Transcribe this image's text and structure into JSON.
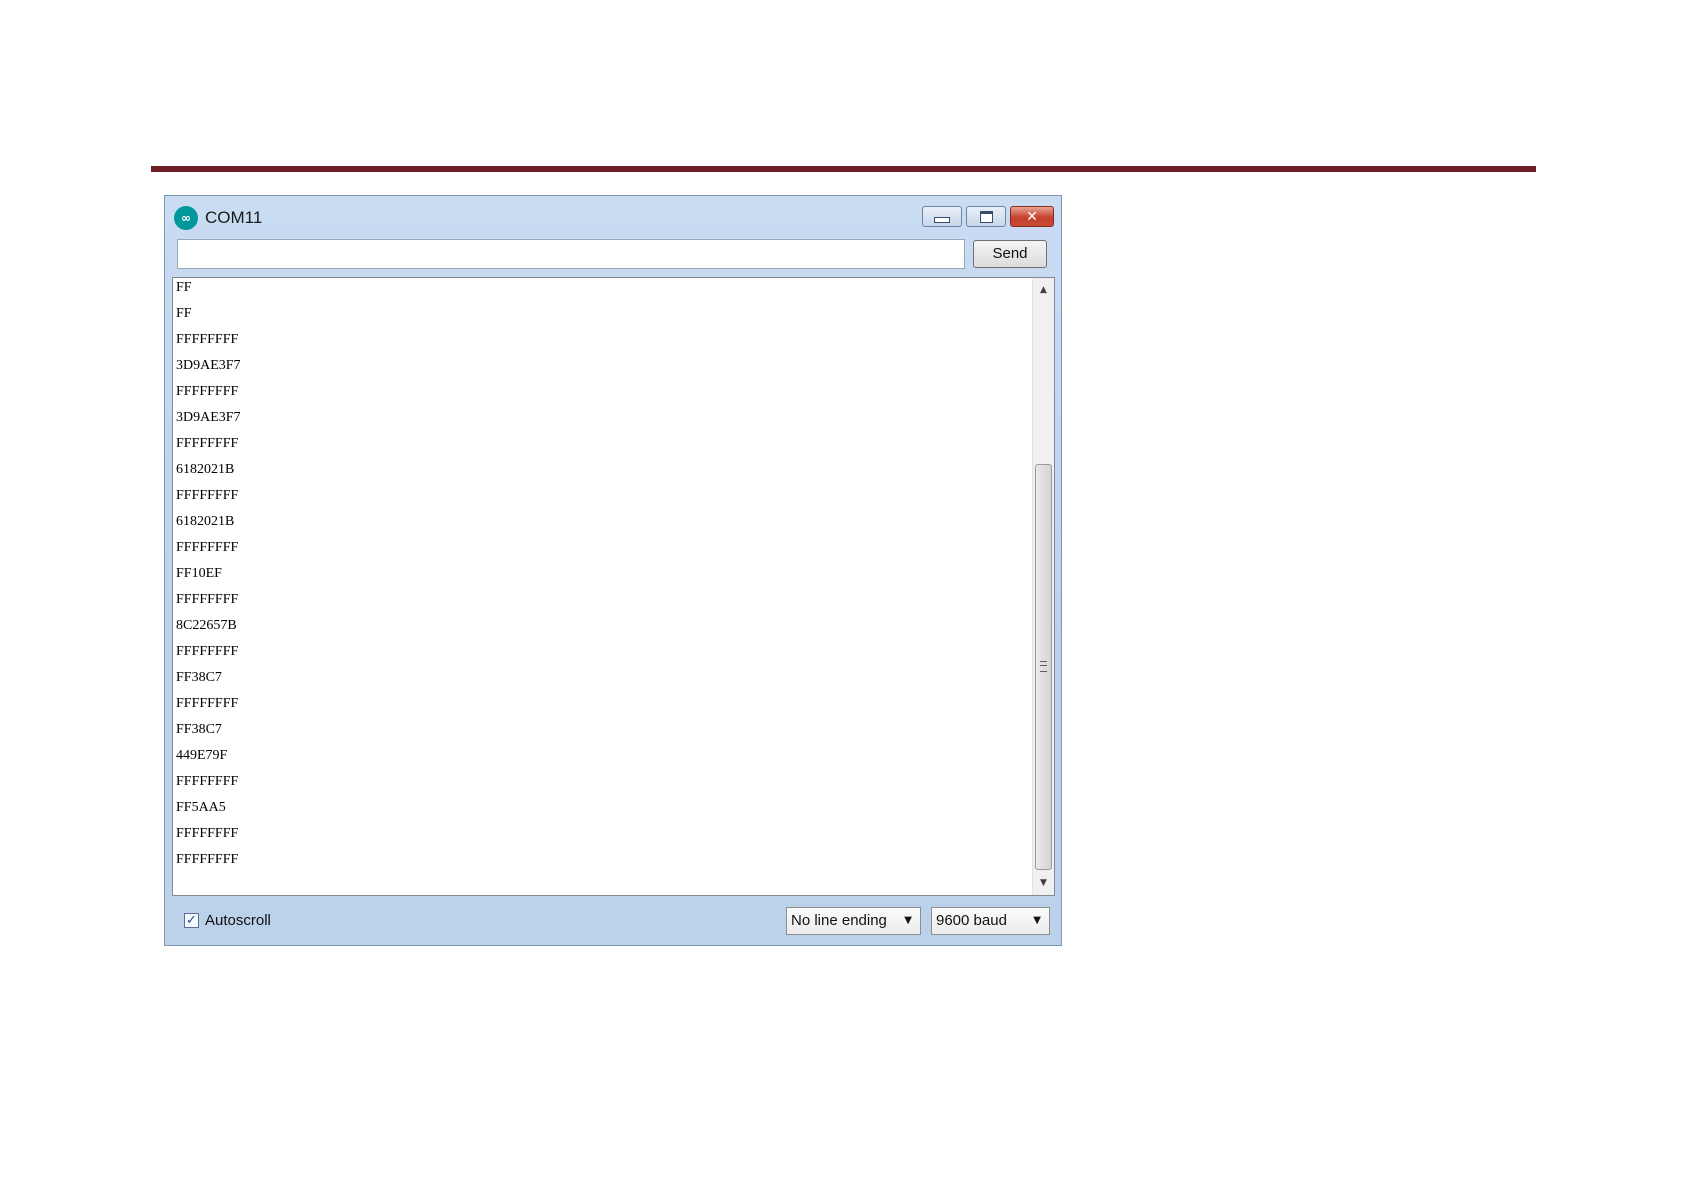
{
  "window": {
    "title": "COM11",
    "app_icon": "arduino-logo-icon",
    "app_icon_glyph": "∞",
    "controls": {
      "minimize": "minimize-icon",
      "maximize": "maximize-icon",
      "close": "close-icon",
      "close_glyph": "✕"
    }
  },
  "input": {
    "value": "",
    "placeholder": "",
    "send_label": "Send"
  },
  "output": {
    "lines": [
      "FF",
      "FF",
      "FFFFFFFF",
      "3D9AE3F7",
      "FFFFFFFF",
      "3D9AE3F7",
      "FFFFFFFF",
      "6182021B",
      "FFFFFFFF",
      "6182021B",
      "FFFFFFFF",
      "FF10EF",
      "FFFFFFFF",
      "8C22657B",
      "FFFFFFFF",
      "FF38C7",
      "FFFFFFFF",
      "FF38C7",
      "449E79F",
      "FFFFFFFF",
      "FF5AA5",
      "FFFFFFFF",
      "FFFFFFFF"
    ],
    "scroll": {
      "up_glyph": "▲",
      "down_glyph": "▼"
    }
  },
  "status": {
    "autoscroll_label": "Autoscroll",
    "autoscroll_checked": true,
    "check_glyph": "✓",
    "line_ending": "No line ending",
    "baud": "9600 baud",
    "caret_glyph": "▼"
  },
  "colors": {
    "rule": "#6e1f23",
    "window_frame": "#bcd2ec",
    "close_button": "#c8422d",
    "arduino_teal": "#00979c"
  }
}
